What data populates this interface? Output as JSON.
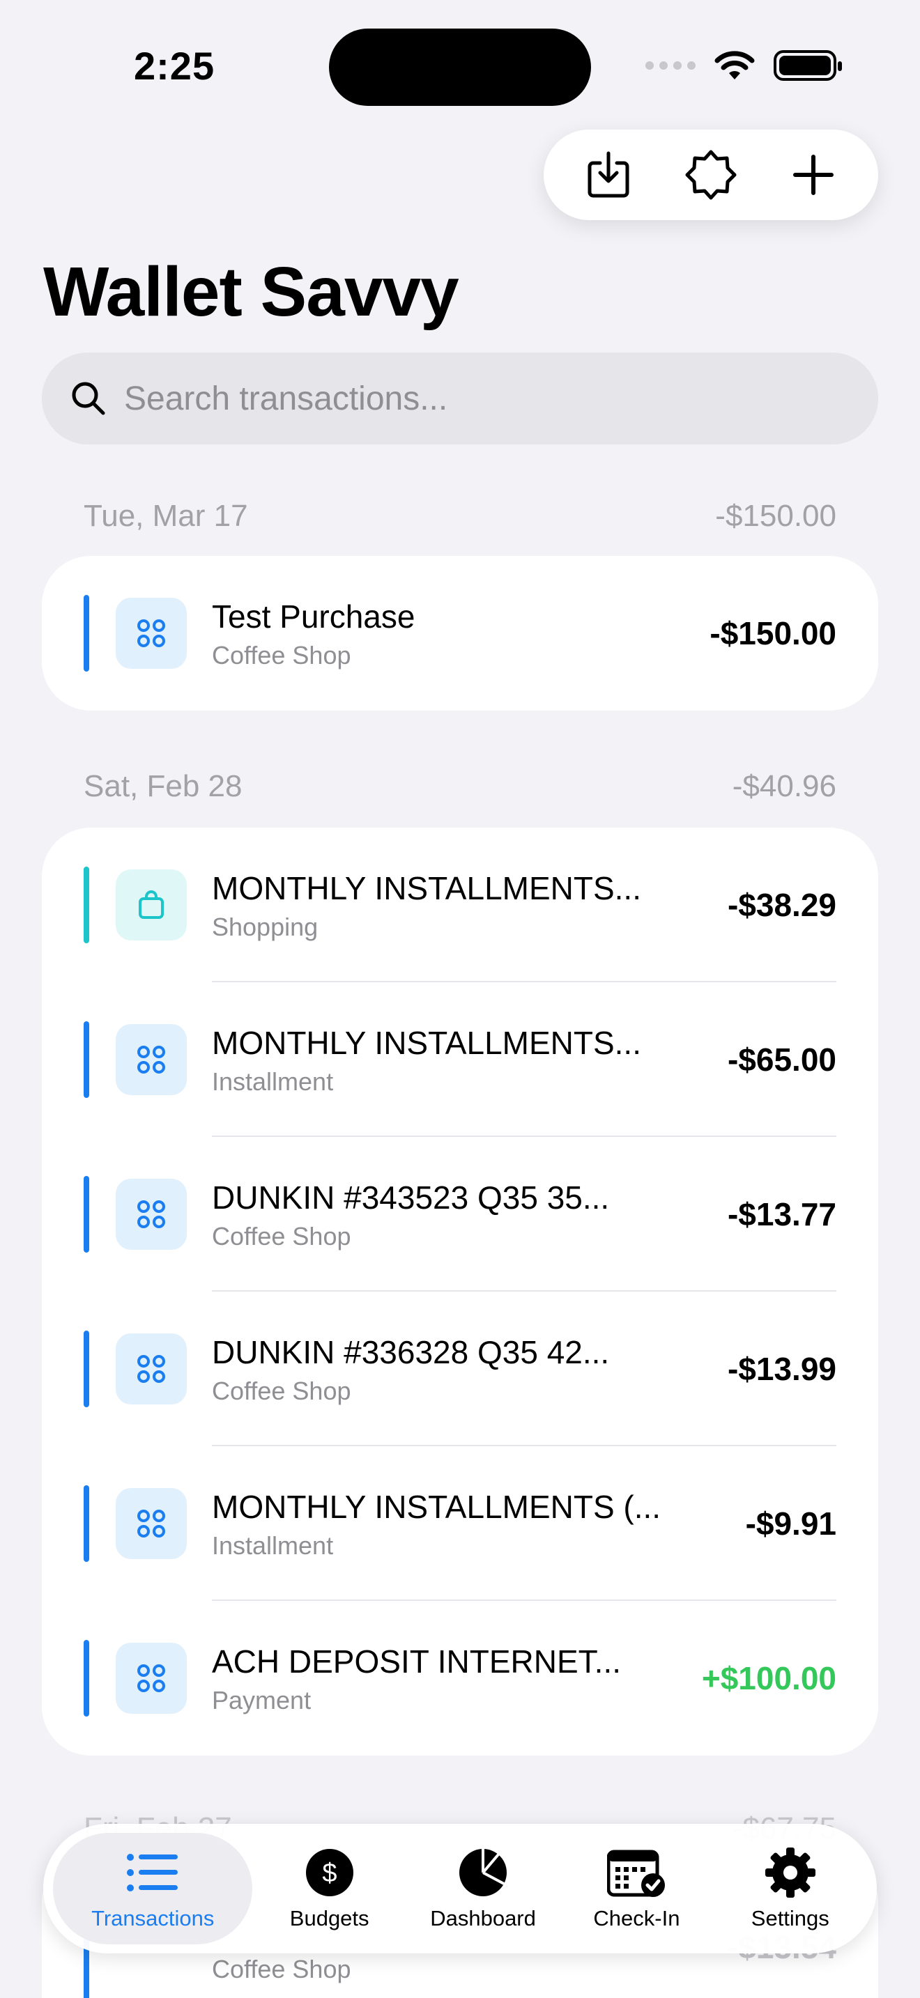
{
  "status": {
    "time": "2:25"
  },
  "app": {
    "title": "Wallet Savvy"
  },
  "toolbar": {
    "import_icon": "tray-download-icon",
    "ai_icon": "sparkle-badge-icon",
    "add_icon": "plus-icon"
  },
  "search": {
    "placeholder": "Search transactions..."
  },
  "sections": [
    {
      "date": "Tue, Mar 17",
      "total": "-$150.00",
      "rows": [
        {
          "name": "Test Purchase",
          "category": "Coffee Shop",
          "amount": "-$150.00",
          "icon": "grid-icon"
        }
      ]
    },
    {
      "date": "Sat, Feb 28",
      "total": "-$40.96",
      "rows": [
        {
          "name": "MONTHLY INSTALLMENTS...",
          "category": "Shopping",
          "amount": "-$38.29",
          "icon": "shopping-bag-icon"
        },
        {
          "name": "MONTHLY INSTALLMENTS...",
          "category": "Installment",
          "amount": "-$65.00",
          "icon": "grid-icon"
        },
        {
          "name": "DUNKIN #343523 Q35 35...",
          "category": "Coffee Shop",
          "amount": "-$13.77",
          "icon": "grid-icon"
        },
        {
          "name": "DUNKIN #336328 Q35 42...",
          "category": "Coffee Shop",
          "amount": "-$13.99",
          "icon": "grid-icon"
        },
        {
          "name": "MONTHLY INSTALLMENTS (...",
          "category": "Installment",
          "amount": "-$9.91",
          "icon": "grid-icon"
        },
        {
          "name": "ACH DEPOSIT INTERNET...",
          "category": "Payment",
          "amount": "+$100.00",
          "icon": "grid-icon"
        }
      ]
    }
  ],
  "peek": {
    "date": "Fri, Feb 27",
    "total": "-$67.75",
    "category": "Coffee Shop",
    "amount": "-$13.54"
  },
  "tabs": [
    {
      "label": "Transactions",
      "icon": "list-icon",
      "active": true
    },
    {
      "label": "Budgets",
      "icon": "dollar-circle-icon"
    },
    {
      "label": "Dashboard",
      "icon": "pie-chart-icon"
    },
    {
      "label": "Check-In",
      "icon": "calendar-check-icon"
    },
    {
      "label": "Settings",
      "icon": "gear-icon"
    }
  ],
  "colors": {
    "accent": "#1a7ef0",
    "teal": "#1cc5c9",
    "positive": "#34c759"
  }
}
